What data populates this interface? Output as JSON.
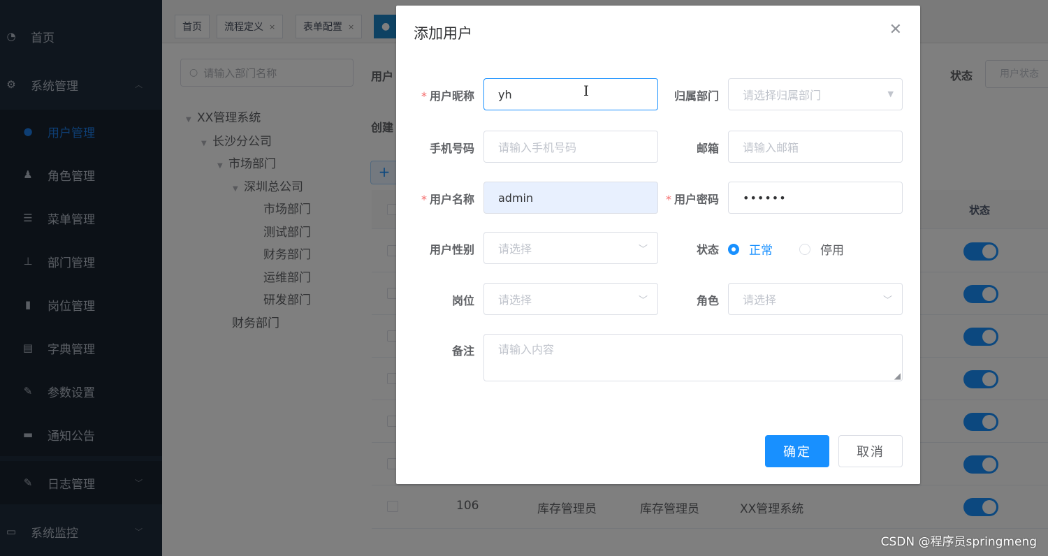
{
  "sidebar": {
    "items": [
      {
        "label": "首页",
        "icon": "dashboard-icon"
      },
      {
        "label": "系统管理",
        "icon": "gear-icon"
      },
      {
        "label": "用户管理",
        "icon": "user-icon"
      },
      {
        "label": "角色管理",
        "icon": "role-icon"
      },
      {
        "label": "菜单管理",
        "icon": "menu-tree-icon"
      },
      {
        "label": "部门管理",
        "icon": "org-chart-icon"
      },
      {
        "label": "岗位管理",
        "icon": "post-icon"
      },
      {
        "label": "字典管理",
        "icon": "dictionary-icon"
      },
      {
        "label": "参数设置",
        "icon": "edit-icon"
      },
      {
        "label": "通知公告",
        "icon": "message-icon"
      },
      {
        "label": "日志管理",
        "icon": "log-icon"
      },
      {
        "label": "系统监控",
        "icon": "monitor-icon"
      }
    ]
  },
  "tabs": [
    {
      "label": "首页"
    },
    {
      "label": "流程定义"
    },
    {
      "label": "表单配置"
    }
  ],
  "dept": {
    "search_placeholder": "请输入部门名称",
    "tree": [
      "XX管理系统",
      "长沙分公司",
      "市场部门",
      "深圳总公司",
      "市场部门",
      "测试部门",
      "财务部门",
      "运维部门",
      "研发部门",
      "财务部门"
    ]
  },
  "filter": {
    "user_label_stub": "用户",
    "created_label_stub": "创建",
    "status_label": "状态",
    "status_placeholder": "用户状态"
  },
  "table": {
    "status_header": "状态",
    "last_row": {
      "id": "106",
      "name": "库存管理员",
      "nick": "库存管理员",
      "dept": "XX管理系统"
    }
  },
  "dialog": {
    "title": "添加用户",
    "fields": {
      "nickname_label": "用户昵称",
      "nickname_value": "yh",
      "dept_label": "归属部门",
      "dept_placeholder": "请选择归属部门",
      "phone_label": "手机号码",
      "phone_placeholder": "请输入手机号码",
      "email_label": "邮箱",
      "email_placeholder": "请输入邮箱",
      "username_label": "用户名称",
      "username_value": "admin",
      "password_label": "用户密码",
      "password_value": "••••••",
      "gender_label": "用户性别",
      "gender_placeholder": "请选择",
      "status_label": "状态",
      "status_normal": "正常",
      "status_disabled": "停用",
      "post_label": "岗位",
      "post_placeholder": "请选择",
      "role_label": "角色",
      "role_placeholder": "请选择",
      "remark_label": "备注",
      "remark_placeholder": "请输入内容"
    },
    "confirm": "确定",
    "cancel": "取消",
    "required_mark": "*"
  },
  "watermark": "CSDN @程序员springmeng"
}
